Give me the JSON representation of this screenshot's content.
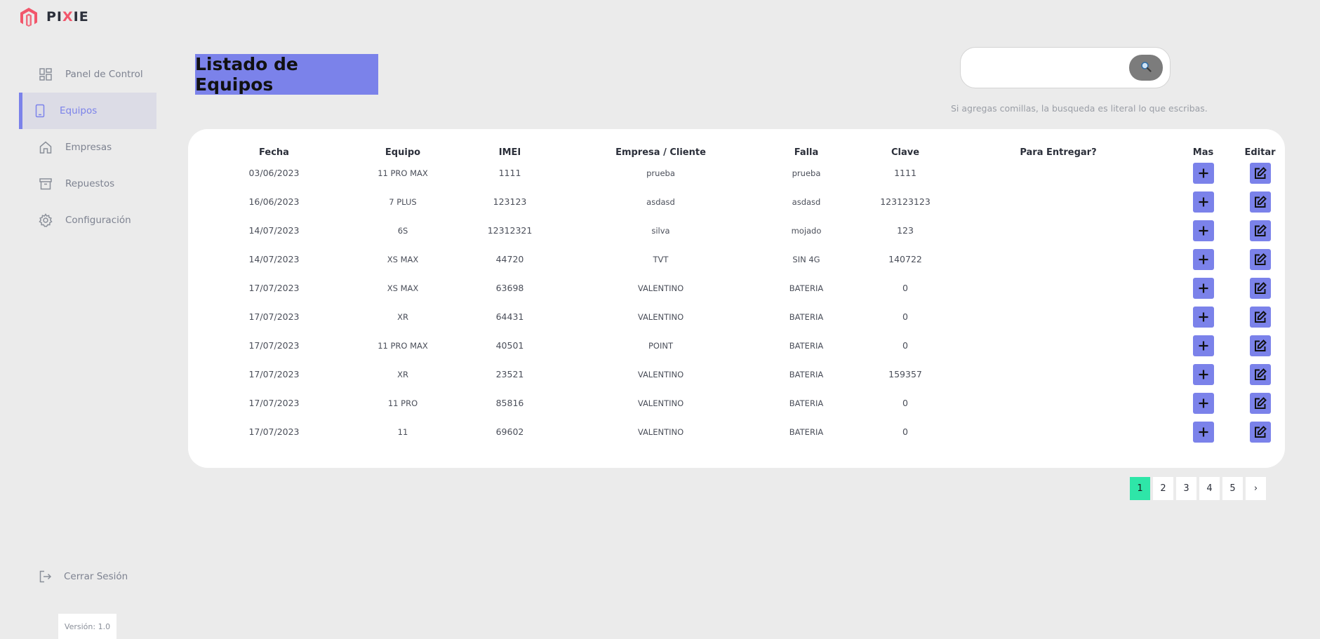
{
  "brand": {
    "prefix": "PI",
    "x": "X",
    "suffix": "IE"
  },
  "sidebar": {
    "items": [
      {
        "label": "Panel de Control",
        "icon": "dashboard-icon"
      },
      {
        "label": "Equipos",
        "icon": "phone-icon",
        "active": true
      },
      {
        "label": "Empresas",
        "icon": "home-icon"
      },
      {
        "label": "Repuestos",
        "icon": "archive-icon"
      },
      {
        "label": "Configuración",
        "icon": "gear-icon"
      }
    ],
    "logout_label": "Cerrar Sesión",
    "version": "Versión: 1.0"
  },
  "header": {
    "title": "Listado de Equipos",
    "search_value": "",
    "search_hint": "Si agregas comillas, la busqueda es literal lo que escribas."
  },
  "table": {
    "columns": [
      "Fecha",
      "Equipo",
      "IMEI",
      "Empresa / Cliente",
      "Falla",
      "Clave",
      "Para Entregar?",
      "Mas",
      "Editar"
    ],
    "rows": [
      [
        "03/06/2023",
        "11 PRO MAX",
        "1111",
        "prueba",
        "prueba",
        "1111",
        ""
      ],
      [
        "16/06/2023",
        "7 PLUS",
        "123123",
        "asdasd",
        "asdasd",
        "123123123",
        ""
      ],
      [
        "14/07/2023",
        "6S",
        "12312321",
        "silva",
        "mojado",
        "123",
        ""
      ],
      [
        "14/07/2023",
        "XS MAX",
        "44720",
        "TVT",
        "SIN 4G",
        "140722",
        ""
      ],
      [
        "17/07/2023",
        "XS MAX",
        "63698",
        "VALENTINO",
        "BATERIA",
        "0",
        ""
      ],
      [
        "17/07/2023",
        "XR",
        "64431",
        "VALENTINO",
        "BATERIA",
        "0",
        ""
      ],
      [
        "17/07/2023",
        "11 PRO MAX",
        "40501",
        "POINT",
        "BATERIA",
        "0",
        ""
      ],
      [
        "17/07/2023",
        "XR",
        "23521",
        "VALENTINO",
        "BATERIA",
        "159357",
        ""
      ],
      [
        "17/07/2023",
        "11 PRO",
        "85816",
        "VALENTINO",
        "BATERIA",
        "0",
        ""
      ],
      [
        "17/07/2023",
        "11",
        "69602",
        "VALENTINO",
        "BATERIA",
        "0",
        ""
      ]
    ]
  },
  "pagination": {
    "pages": [
      "1",
      "2",
      "3",
      "4",
      "5"
    ],
    "current": "1",
    "next": "›"
  },
  "colors": {
    "accent": "#7b82ea",
    "active_page": "#2ee6a8",
    "brand_red": "#f2566b"
  }
}
